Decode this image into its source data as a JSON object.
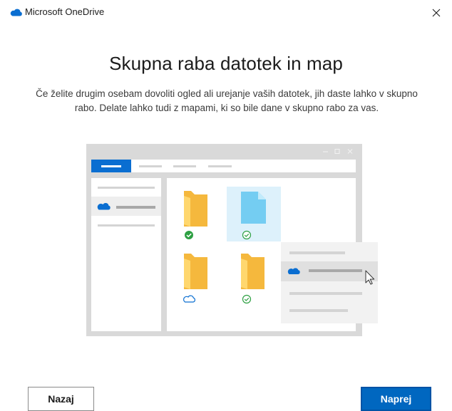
{
  "window": {
    "app_title": "Microsoft OneDrive",
    "close_icon": "close-icon",
    "logo_icon": "onedrive-cloud-icon"
  },
  "content": {
    "heading": "Skupna raba datotek in map",
    "description": "Če želite drugim osebam dovoliti ogled ali urejanje vaših datotek, jih daste lahko v skupno rabo. Delate lahko tudi z mapami, ki so bile dane v skupno rabo za vas."
  },
  "illustration": {
    "window_controls": "– ▢ ✕",
    "items": [
      {
        "icon": "folder-icon",
        "status": "synced-check-filled"
      },
      {
        "icon": "file-icon",
        "status": "synced-check-outline",
        "selected": true
      },
      {
        "icon": "folder-icon",
        "status": "cloud-only"
      },
      {
        "icon": "folder-icon",
        "status": "synced-check-outline"
      }
    ],
    "context_menu_icon": "onedrive-cloud-icon",
    "cursor_icon": "mouse-pointer-icon"
  },
  "buttons": {
    "back_label": "Nazaj",
    "next_label": "Naprej"
  },
  "colors": {
    "accent": "#0067c0",
    "onedrive_blue": "#0a6ed1",
    "success_green": "#2ea043",
    "folder_yellow": "#f5b83d"
  }
}
